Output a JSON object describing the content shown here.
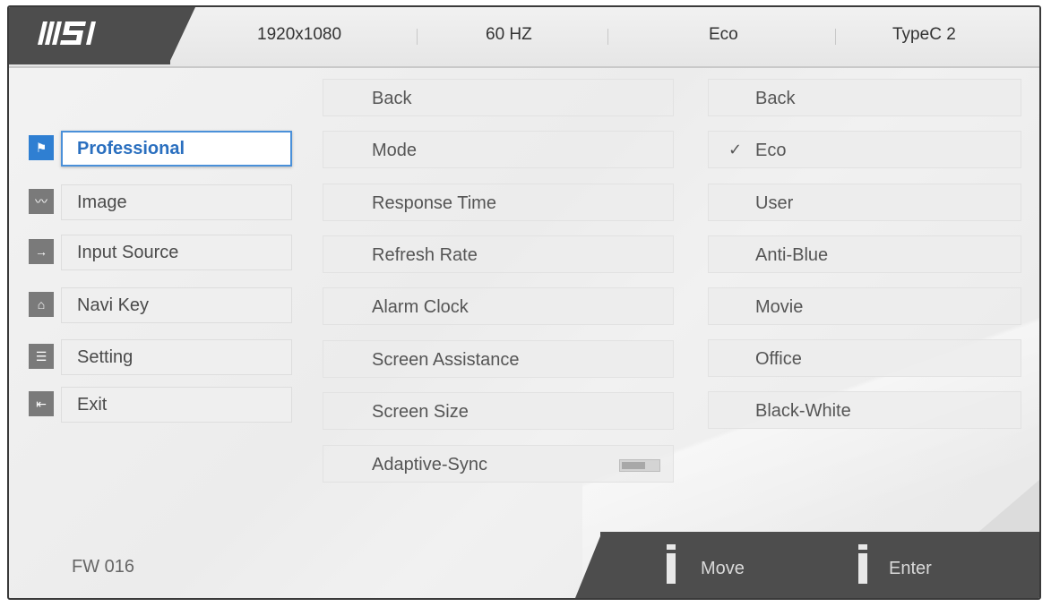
{
  "brand": {
    "logo_text": "msi"
  },
  "status_bar": {
    "resolution": "1920x1080",
    "refresh": "60 HZ",
    "mode": "Eco",
    "input": "TypeC 2"
  },
  "menu": {
    "items": [
      {
        "label": "Professional",
        "icon": "flag-icon"
      },
      {
        "label": "Image",
        "icon": "image-icon"
      },
      {
        "label": "Input Source",
        "icon": "arrow-right-icon"
      },
      {
        "label": "Navi Key",
        "icon": "navi-key-icon"
      },
      {
        "label": "Setting",
        "icon": "sliders-icon"
      },
      {
        "label": "Exit",
        "icon": "exit-icon"
      }
    ],
    "active_index": 0
  },
  "submenu": {
    "items": [
      {
        "label": "Back"
      },
      {
        "label": "Mode"
      },
      {
        "label": "Response Time"
      },
      {
        "label": "Refresh Rate"
      },
      {
        "label": "Alarm Clock"
      },
      {
        "label": "Screen Assistance"
      },
      {
        "label": "Screen Size"
      },
      {
        "label": "Adaptive-Sync",
        "toggle": true,
        "toggle_state": "off"
      }
    ]
  },
  "options": {
    "items": [
      {
        "label": "Back"
      },
      {
        "label": "Eco",
        "selected": true,
        "check_glyph": "✓"
      },
      {
        "label": "User"
      },
      {
        "label": "Anti-Blue"
      },
      {
        "label": "Movie"
      },
      {
        "label": "Office"
      },
      {
        "label": "Black-White"
      }
    ]
  },
  "footer": {
    "firmware": "FW 016",
    "move_label": "Move",
    "enter_label": "Enter"
  },
  "colors": {
    "accent": "#2f7fd2",
    "dark_bar": "#4d4d4d",
    "background": "#efefef"
  }
}
